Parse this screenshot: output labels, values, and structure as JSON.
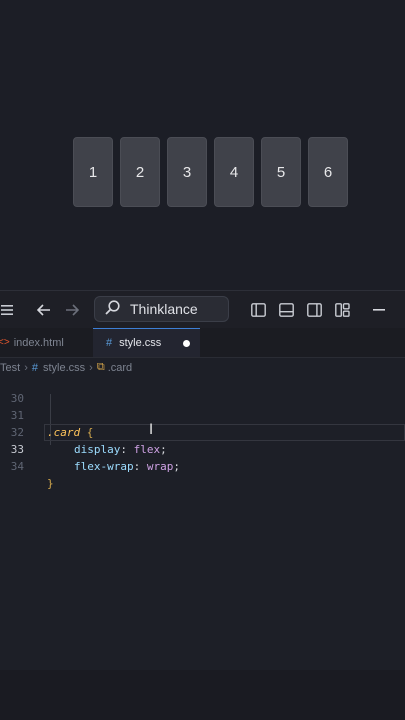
{
  "preview": {
    "cards": [
      "1",
      "2",
      "3",
      "4",
      "5",
      "6"
    ]
  },
  "titlebar": {
    "search_label": "Thinklance"
  },
  "tabs": [
    {
      "label": "index.html",
      "active": false
    },
    {
      "label": "style.css",
      "active": true,
      "modified": true
    }
  ],
  "breadcrumb": {
    "folder": "Test",
    "file": "style.css",
    "symbol": ".card"
  },
  "editor": {
    "lines": [
      {
        "num": "30"
      },
      {
        "num": "31",
        "selector": ".card",
        "brace": "{"
      },
      {
        "num": "32",
        "property": "display",
        "value": "flex"
      },
      {
        "num": "33",
        "property": "flex-wrap",
        "value": "wrap"
      },
      {
        "num": "34",
        "brace": "}"
      }
    ]
  },
  "colors": {
    "accent": "#3d7fd6",
    "selector": "#ffc45b",
    "property": "#9cdcfe",
    "value": "#cfa2e5"
  }
}
